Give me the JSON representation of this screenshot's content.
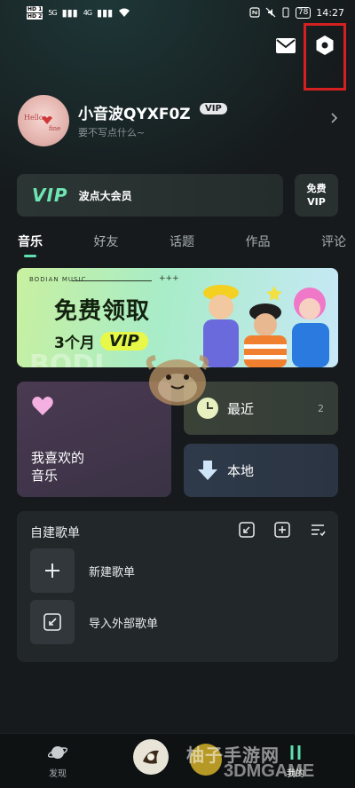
{
  "status_bar": {
    "sim1": "HD 1",
    "sim2": "HD 2",
    "net1": "5G",
    "net2": "4G",
    "battery": "78",
    "time": "14:27"
  },
  "header": {
    "mail_icon": "mail-icon",
    "settings_icon": "gear-icon"
  },
  "profile": {
    "username": "小音波QYXF0Z",
    "vip_badge": "VIP",
    "signature": "要不写点什么~"
  },
  "vip_row": {
    "logo": "VIP",
    "name": "波点大会员",
    "free_line1": "免费",
    "free_line2": "VIP"
  },
  "tabs": [
    {
      "label": "音乐",
      "active": true
    },
    {
      "label": "好友",
      "active": false
    },
    {
      "label": "话题",
      "active": false
    },
    {
      "label": "作品",
      "active": false
    },
    {
      "label": "评论",
      "active": false
    }
  ],
  "banner": {
    "brand": "BODIAN MUSIC",
    "dots": "+++",
    "headline": "免费领取",
    "months": "3个月",
    "vip": "VIP",
    "watermark": "BODI"
  },
  "cards": {
    "favorites": {
      "line1": "我喜欢的",
      "line2": "音乐"
    },
    "recent": {
      "label": "最近",
      "count": "2"
    },
    "local": {
      "label": "本地"
    }
  },
  "playlists": {
    "title": "自建歌单",
    "items": [
      {
        "label": "新建歌单",
        "icon": "plus-icon"
      },
      {
        "label": "导入外部歌单",
        "icon": "import-icon"
      }
    ]
  },
  "bottom_nav": {
    "discover": "发现",
    "mine": "我的"
  },
  "watermark": {
    "site_cn": "柚子手游网",
    "site_en": "3DMGAME"
  },
  "colors": {
    "accent": "#5fe0b0",
    "background": "#161a1c",
    "highlight": "#d42020"
  }
}
